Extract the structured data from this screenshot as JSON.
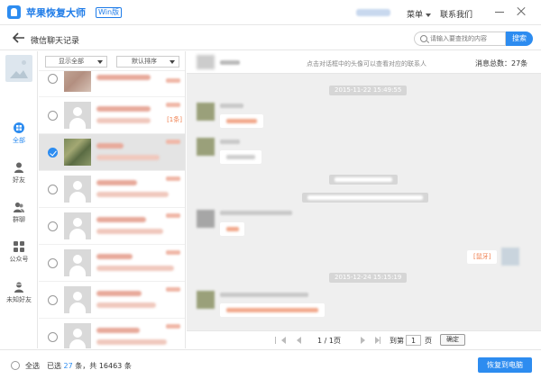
{
  "app": {
    "title": "苹果恢复大师",
    "edition_badge": "Win版",
    "menu_label": "菜单",
    "contact_us_label": "联系我们"
  },
  "subheader": {
    "title": "微信聊天记录",
    "search_placeholder": "请输入要查找的内容",
    "search_button": "搜索"
  },
  "nav": {
    "items": [
      {
        "label": "全部",
        "icon": "grid-icon",
        "active": true
      },
      {
        "label": "好友",
        "icon": "person-icon",
        "active": false
      },
      {
        "label": "群聊",
        "icon": "group-icon",
        "active": false
      },
      {
        "label": "公众号",
        "icon": "apps-icon",
        "active": false
      },
      {
        "label": "未知好友",
        "icon": "unknown-person-icon",
        "active": false
      }
    ]
  },
  "contacts": {
    "filter_label": "显示全部",
    "sort_label": "默认排序",
    "rows": [
      {
        "selected": false,
        "avatar": "photo2",
        "count": ""
      },
      {
        "selected": false,
        "avatar": "default",
        "count": "[1条]"
      },
      {
        "selected": true,
        "avatar": "photo",
        "count": ""
      },
      {
        "selected": false,
        "avatar": "default",
        "count": ""
      },
      {
        "selected": false,
        "avatar": "default",
        "count": ""
      },
      {
        "selected": false,
        "avatar": "default",
        "count": ""
      },
      {
        "selected": false,
        "avatar": "default",
        "count": ""
      },
      {
        "selected": false,
        "avatar": "default",
        "count": ""
      }
    ]
  },
  "chat": {
    "hint": "点击对话框中的头像可以查看对应的联系人",
    "total_label": "消息总数：27条",
    "timestamp_1": "2015-11-22 15:49:55",
    "timestamp_2": "2015-12-24 15:15:19",
    "outgoing_message": "[鼠牙]"
  },
  "pager": {
    "page_info": "1 / 1页",
    "goto_label": "到第",
    "page_input": "1",
    "page_unit": "页",
    "ok_label": "确定"
  },
  "footer": {
    "select_all_label": "全选",
    "selected_prefix": "已选",
    "selected_count": "27",
    "selected_suffix": "条，共 16463 条",
    "restore_button": "恢复到电脑"
  },
  "colors": {
    "accent": "#2d8cf0",
    "highlight": "#f08050",
    "chat_bg": "#efefef"
  }
}
